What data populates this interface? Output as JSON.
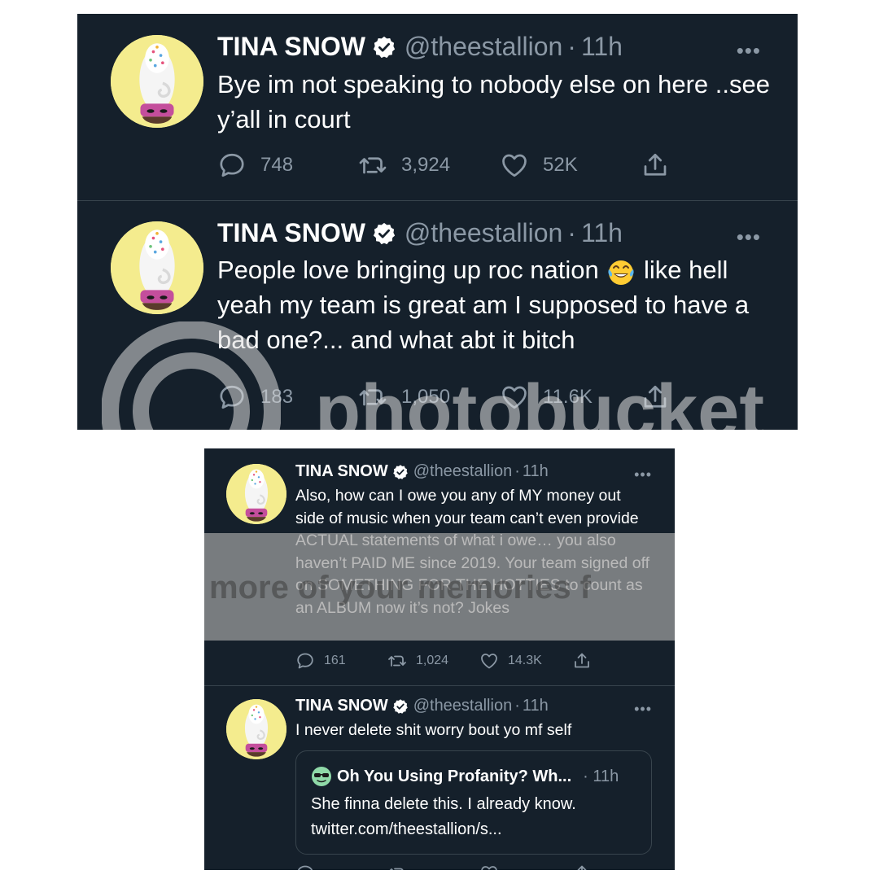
{
  "colors": {
    "background": "#15202b",
    "text": "#ffffff",
    "muted": "#8b98a5",
    "verified": "#ffffff",
    "divider": "#38444d"
  },
  "tweets": [
    {
      "name": "TINA SNOW",
      "handle": "@theestallion",
      "dot": "·",
      "time": "11h",
      "more": "•••",
      "text": "Bye im not speaking to nobody else on here ..see y’all in court",
      "replies": "748",
      "retweets": "3,924",
      "likes": "52K"
    },
    {
      "name": "TINA SNOW",
      "handle": "@theestallion",
      "dot": "·",
      "time": "11h",
      "more": "•••",
      "text_before_emoji": "People love bringing up roc nation ",
      "emoji": "face-with-tears-of-joy",
      "text_after_emoji": " like hell yeah my team is great am I supposed to have a bad one?... and what abt it bitch",
      "replies": "183",
      "retweets": "1,050",
      "likes": "11.6K"
    },
    {
      "name": "TINA SNOW",
      "handle": "@theestallion",
      "dot": "·",
      "time": "11h",
      "more": "•••",
      "text": "Also, how can I owe you any of MY money out side of music when your team can’t even provide ACTUAL statements of what i owe… you also haven’t PAID ME since 2019. Your team signed off on SOMETHING FOR THE HOTTIES to count as an ALBUM now it’s not? Jokes",
      "replies": "161",
      "retweets": "1,024",
      "likes": "14.3K"
    },
    {
      "name": "TINA SNOW",
      "handle": "@theestallion",
      "dot": "·",
      "time": "11h",
      "more": "•••",
      "text": "I never delete shit worry bout yo mf self",
      "quote": {
        "emoji": "sunglasses-face",
        "name": "Oh You Using Profanity? Wh...",
        "time": "· 11h",
        "text": "She finna delete this. I already know. twitter.com/theestallion/s..."
      }
    }
  ],
  "watermarks": {
    "top": "photobucket",
    "bottom": "more of your memories f"
  },
  "icons": [
    "reply-icon",
    "retweet-icon",
    "like-icon",
    "share-icon",
    "verified-badge-icon",
    "more-options-icon",
    "avatar-image"
  ]
}
